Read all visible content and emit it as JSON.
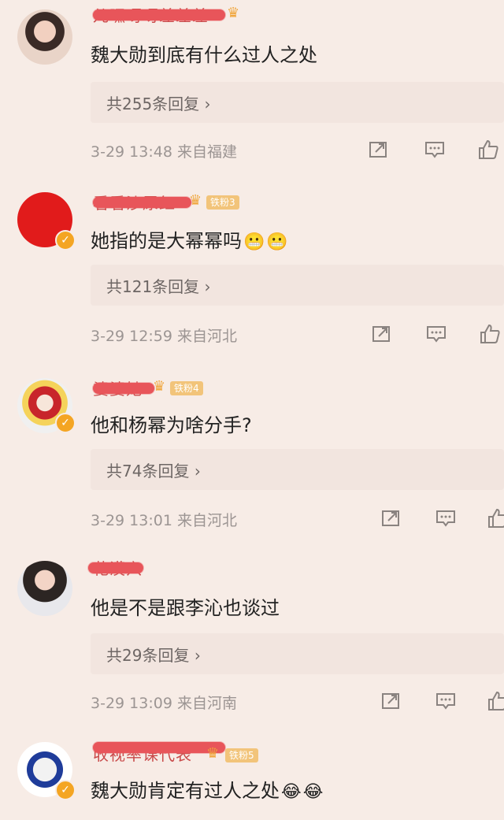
{
  "comments": [
    {
      "username": "儿嘿呀呀差差差",
      "has_crown": true,
      "fan_badge": "",
      "verified": false,
      "text": "魏大勋到底有什么过人之处",
      "emojis": [],
      "replies_label": "共255条回复",
      "date": "3-29",
      "time": "13:48",
      "location": "来自福建"
    },
    {
      "username": "看看沙尿红",
      "has_crown": true,
      "fan_badge": "铁粉3",
      "verified": true,
      "text": "她指的是大幂幂吗",
      "emojis": [
        "😬",
        "😬"
      ],
      "replies_label": "共121条回复",
      "date": "3-29",
      "time": "12:59",
      "location": "来自河北"
    },
    {
      "username": "婆婆她",
      "has_crown": true,
      "fan_badge": "铁粉4",
      "verified": true,
      "text": "他和杨幂为啥分手?",
      "emojis": [],
      "replies_label": "共74条回复",
      "date": "3-29",
      "time": "13:01",
      "location": "来自河北"
    },
    {
      "username": "花漠穴",
      "has_crown": false,
      "fan_badge": "",
      "verified": false,
      "text": "他是不是跟李沁也谈过",
      "emojis": [],
      "replies_label": "共29条回复",
      "date": "3-29",
      "time": "13:09",
      "location": "来自河南"
    },
    {
      "username": "收视率课代表",
      "has_crown": true,
      "fan_badge": "铁粉5",
      "verified": true,
      "text": "魏大勋肯定有过人之处",
      "emojis": [
        "😂",
        "😂"
      ],
      "replies_label": "",
      "date": "",
      "time": "",
      "location": ""
    }
  ],
  "icons": {
    "chevron": "›",
    "share": "share-icon",
    "comment": "comment-icon",
    "like": "thumbs-up-icon"
  },
  "colors": {
    "background": "#f7ece6",
    "mask_red": "#e8555a",
    "meta_gray": "#9c9593",
    "verified_orange": "#f4a523"
  }
}
